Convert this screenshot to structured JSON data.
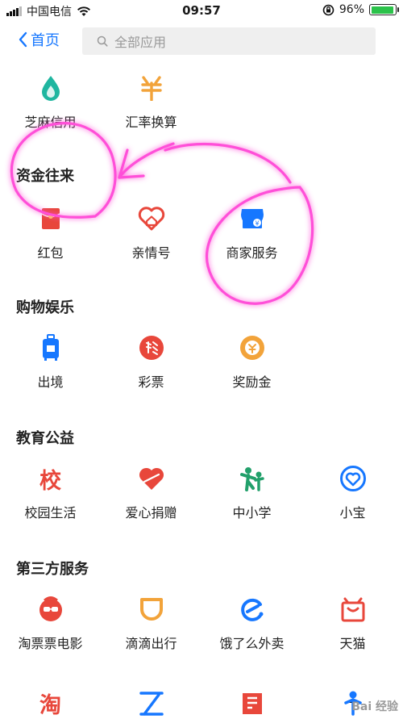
{
  "status_bar": {
    "carrier": "中国电信",
    "time": "09:57",
    "battery_percent": "96%",
    "battery_level": 0.96,
    "icons": [
      "signal-icon",
      "wifi-icon",
      "lock-rotation-icon",
      "battery-icon"
    ]
  },
  "nav": {
    "back_label": "首页",
    "search_placeholder": "全部应用"
  },
  "top_apps": [
    {
      "label": "芝麻信用",
      "icon": "sesame-credit-icon",
      "color": "#1fb6a0"
    },
    {
      "label": "汇率换算",
      "icon": "exchange-rate-icon",
      "color": "#f2a33a"
    }
  ],
  "sections": {
    "funds": {
      "title": "资金往来",
      "apps": [
        {
          "label": "红包",
          "icon": "red-packet-icon",
          "color": "#e8473b"
        },
        {
          "label": "亲情号",
          "icon": "family-heart-icon",
          "color": "#e8473b"
        },
        {
          "label": "商家服务",
          "icon": "merchant-service-icon",
          "color": "#1677ff"
        }
      ]
    },
    "shopping": {
      "title": "购物娱乐",
      "apps": [
        {
          "label": "出境",
          "icon": "luggage-icon",
          "color": "#1677ff"
        },
        {
          "label": "彩票",
          "icon": "lottery-icon",
          "color": "#e8473b"
        },
        {
          "label": "奖励金",
          "icon": "reward-coin-icon",
          "color": "#f2a33a"
        }
      ]
    },
    "education": {
      "title": "教育公益",
      "apps": [
        {
          "label": "校园生活",
          "icon": "campus-icon",
          "color": "#e8473b",
          "glyph": "校"
        },
        {
          "label": "爱心捐赠",
          "icon": "charity-heart-icon",
          "color": "#e8473b"
        },
        {
          "label": "中小学",
          "icon": "school-kids-icon",
          "color": "#22a06b"
        },
        {
          "label": "小宝",
          "icon": "xiaobao-icon",
          "color": "#1677ff"
        }
      ]
    },
    "third_party": {
      "title": "第三方服务",
      "apps": [
        {
          "label": "淘票票电影",
          "icon": "taopiaopiao-icon",
          "color": "#e8473b"
        },
        {
          "label": "滴滴出行",
          "icon": "didi-icon",
          "color": "#f2a33a"
        },
        {
          "label": "饿了么外卖",
          "icon": "eleme-icon",
          "color": "#1677ff"
        },
        {
          "label": "天猫",
          "icon": "tmall-icon",
          "color": "#e8473b"
        }
      ]
    }
  },
  "bottom_partial_apps": [
    {
      "icon": "taobao-icon",
      "color": "#e8473b",
      "glyph": "淘"
    },
    {
      "icon": "train-ticket-icon",
      "color": "#1677ff"
    },
    {
      "icon": "hotel-icon",
      "color": "#e8473b"
    },
    {
      "icon": "person-icon",
      "color": "#1677ff"
    }
  ],
  "watermark": "Bai 经验",
  "annotation_color": "#ff4fd8"
}
